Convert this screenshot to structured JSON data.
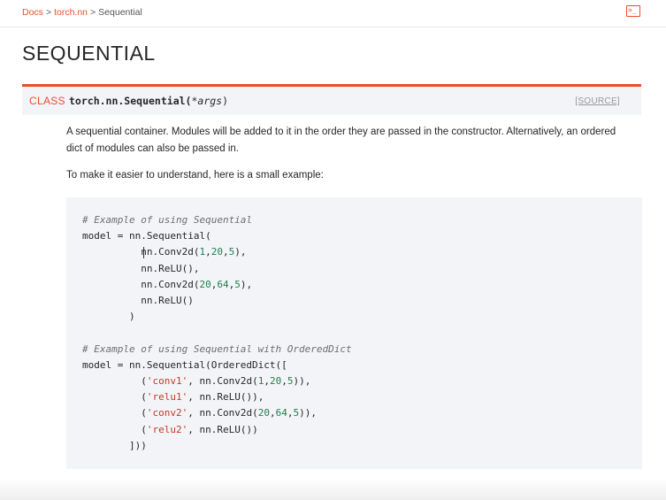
{
  "breadcrumb": {
    "items": [
      "Docs",
      "torch.nn",
      "Sequential"
    ],
    "separator": ">"
  },
  "toolbar": {
    "terminal_glyph": ">_"
  },
  "page": {
    "title": "SEQUENTIAL"
  },
  "signature": {
    "keyword": "CLASS",
    "name": "torch.nn.Sequential(",
    "args": "*args",
    "close": ")",
    "source_label": "[SOURCE]"
  },
  "description": {
    "p1": "A sequential container. Modules will be added to it in the order they are passed in the constructor. Alternatively, an ordered dict of modules can also be passed in.",
    "p2": "To make it easier to understand, here is a small example:"
  },
  "code": {
    "comment1": "# Example of using Sequential",
    "comment2": "# Example of using Sequential with OrderedDict"
  },
  "colors": {
    "accent": "#ee4c2c",
    "code_bg": "#f3f4f7",
    "number": "#208050",
    "string": "#c13b2a"
  },
  "icons": {
    "terminal": "terminal-icon"
  }
}
